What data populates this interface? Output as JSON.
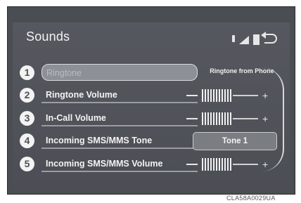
{
  "screen": {
    "title": "Sounds",
    "status_icons": [
      "bluetooth-icon",
      "signal-strength-icon",
      "battery-icon"
    ],
    "back_icon": "back-arrow-icon"
  },
  "rows": [
    {
      "num": "1",
      "label": "Ringtone",
      "setting": "Ringtone from Phone",
      "selected": true
    },
    {
      "num": "2",
      "label": "Ringtone Volume",
      "volume_level": 0.55
    },
    {
      "num": "3",
      "label": "In-Call Volume",
      "volume_level": 0.55
    },
    {
      "num": "4",
      "label": "Incoming SMS/MMS Tone",
      "setting": "Tone 1"
    },
    {
      "num": "5",
      "label": "Incoming SMS/MMS Volume",
      "volume_level": 0.55
    }
  ],
  "volume_minus": "−",
  "volume_plus": "+",
  "image_code": "CLA58A0029UA"
}
